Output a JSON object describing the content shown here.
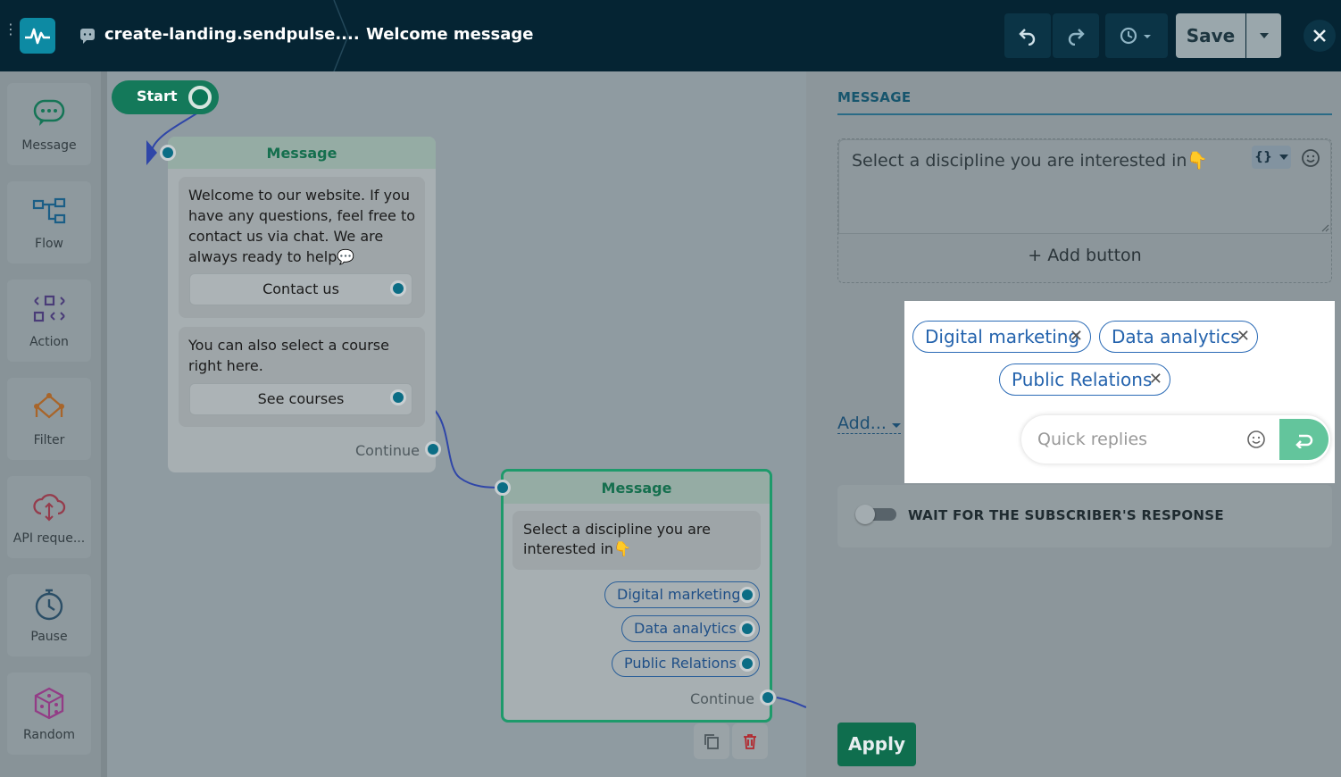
{
  "header": {
    "channel_name": "create-landing.sendpulse....",
    "flow_name": "Welcome message",
    "save_label": "Save"
  },
  "sidebar": {
    "items": [
      {
        "label": "Message",
        "icon": "chat-bubble-icon"
      },
      {
        "label": "Flow",
        "icon": "flow-icon"
      },
      {
        "label": "Action",
        "icon": "action-icon"
      },
      {
        "label": "Filter",
        "icon": "filter-icon"
      },
      {
        "label": "API reque...",
        "icon": "api-cloud-icon"
      },
      {
        "label": "Pause",
        "icon": "stopwatch-icon"
      },
      {
        "label": "Random",
        "icon": "dice-icon"
      }
    ]
  },
  "canvas": {
    "start_label": "Start",
    "node1": {
      "title": "Message",
      "text1": "Welcome to our website. If you have any questions, feel free to contact us via chat. We are always ready to help💬",
      "button1": "Contact us",
      "text2": "You can also select a course right here.",
      "button2": "See courses",
      "continue": "Continue"
    },
    "node2": {
      "title": "Message",
      "text": "Select a discipline you are interested in👇",
      "chips": [
        "Digital marketing",
        "Data analytics",
        "Public Relations"
      ],
      "continue": "Continue"
    }
  },
  "panel": {
    "title": "MESSAGE",
    "message_text": "Select a discipline you are interested in👇",
    "var_label": "{}",
    "add_button": "+ Add button",
    "quick_replies": [
      "Digital marketing",
      "Data analytics",
      "Public Relations"
    ],
    "quick_reply_placeholder": "Quick replies",
    "add_link": "Add...",
    "wait_label": "WAIT FOR THE SUBSCRIBER'S RESPONSE",
    "apply_label": "Apply"
  },
  "colors": {
    "topbar": "#052433",
    "accent_green": "#14795a",
    "chip_blue": "#2463ad",
    "send_green": "#63c59c"
  }
}
